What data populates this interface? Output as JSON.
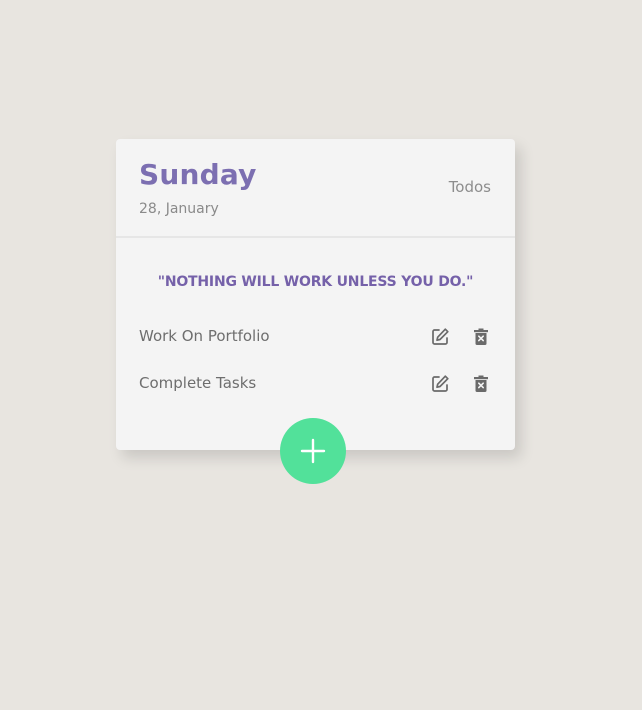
{
  "header": {
    "day": "Sunday",
    "date": "28, January",
    "section_label": "Todos"
  },
  "quote": "\"NOTHING WILL WORK UNLESS YOU DO.\"",
  "tasks": [
    {
      "label": "Work On Portfolio",
      "edit_icon": "edit-icon",
      "delete_icon": "trash-icon"
    },
    {
      "label": "Complete Tasks",
      "edit_icon": "edit-icon",
      "delete_icon": "trash-icon"
    }
  ],
  "add_button": {
    "icon": "plus-icon"
  },
  "colors": {
    "background": "#e8e5e0",
    "card": "#f4f4f4",
    "accent_purple": "#7c6fb1",
    "quote_purple": "#7561a9",
    "fab_green": "#52e19a",
    "text_gray": "#6e6e6e"
  }
}
